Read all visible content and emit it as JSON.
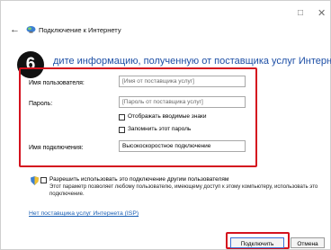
{
  "window": {
    "minimize_glyph": "□",
    "close_glyph": "✕",
    "back_glyph": "←",
    "title": "Подключение к Интернету"
  },
  "step_badge": "6",
  "heading": "дите информацию, полученную от поставщика услуг Интернета",
  "form": {
    "username_label": "Имя пользователя:",
    "username_placeholder": "[Имя от поставщика услуг]",
    "password_label": "Пароль:",
    "password_placeholder": "[Пароль от поставщика услуг]",
    "show_chars_label": "Отображать вводимые знаки",
    "remember_password_label": "Запомнить этот пароль",
    "connection_name_label": "Имя подключения:",
    "connection_name_value": "Высокоскоростное подключение"
  },
  "share": {
    "label": "Разрешить использовать это подключение другим пользователям",
    "description": "Этот параметр позволяет любому пользователю, имеющему доступ к этому компьютеру, использовать это подключение."
  },
  "no_isp_link": "Нет поставщика услуг Интернета (ISP)",
  "buttons": {
    "connect": "Подключить",
    "cancel": "Отмена"
  },
  "colors": {
    "highlight": "#d4121e",
    "link": "#1a5fb4",
    "heading": "#1d4fa6"
  },
  "icons": {
    "network": "network-icon",
    "shield": "shield-icon"
  }
}
